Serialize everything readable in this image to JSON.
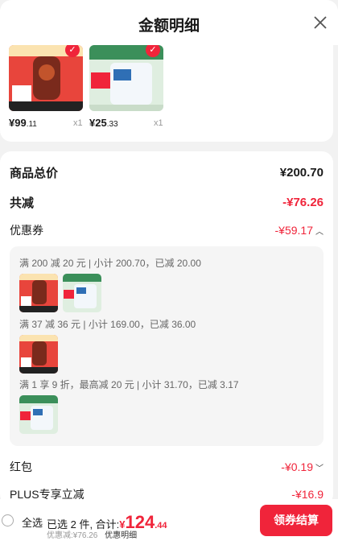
{
  "header": {
    "title": "金额明细"
  },
  "products": [
    {
      "price_int": "¥99",
      "price_dec": ".11",
      "qty": "x1"
    },
    {
      "price_int": "¥25",
      "price_dec": ".33",
      "qty": "x1"
    }
  ],
  "summary": {
    "goods_total_label": "商品总价",
    "goods_total_value": "¥200.70",
    "total_reduce_label": "共减",
    "total_reduce_value": "-¥76.26",
    "coupon_label": "优惠券",
    "coupon_value": "-¥59.17",
    "hongbao_label": "红包",
    "hongbao_value": "-¥0.19",
    "plus_label": "PLUS专享立减",
    "plus_value": "-¥16.9"
  },
  "coupons": [
    {
      "text": "满 200 减 20 元 | 小计 200.70，已减 20.00"
    },
    {
      "text": "满 37 减 36 元 | 小计 169.00，已减 36.00"
    },
    {
      "text": "满 1 享 9 折，最高减 20 元 | 小计 31.70，已减 3.17"
    }
  ],
  "footer": {
    "select_all": "全选",
    "selected_text": "已选 2 件, 合计:",
    "currency": "¥",
    "total_int": "124",
    "total_dec": ".44",
    "discount_text": "优惠减:¥76.26",
    "detail_link": "优惠明细",
    "checkout": "领券结算"
  },
  "colors": {
    "accent": "#f0243a"
  }
}
